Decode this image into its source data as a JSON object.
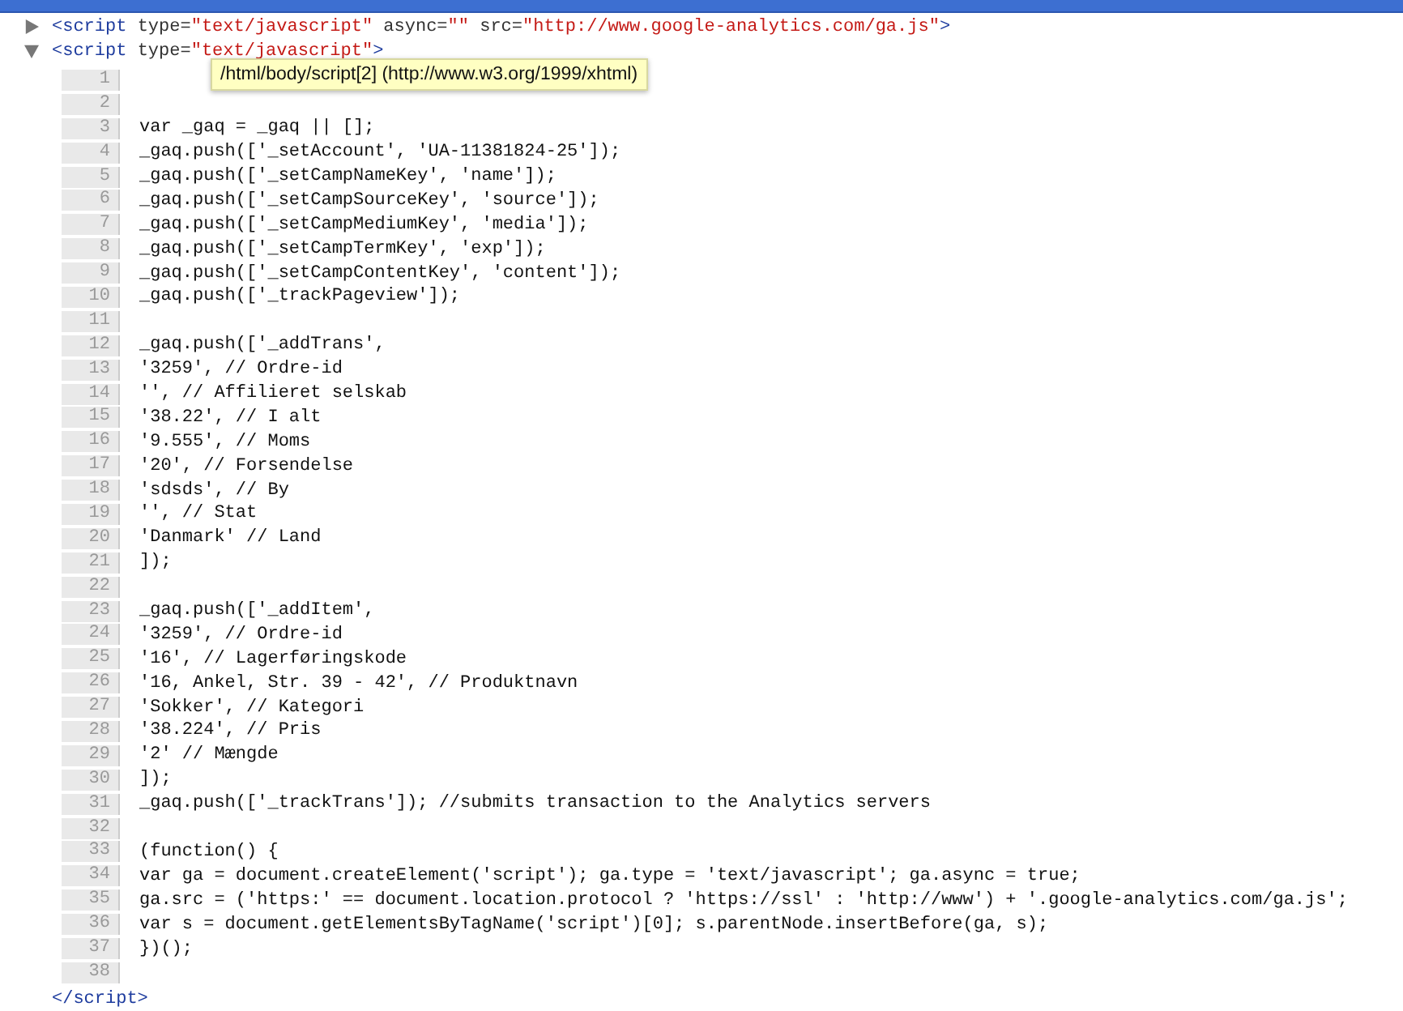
{
  "nodes": [
    {
      "expanded": false,
      "tokens": [
        {
          "kind": "tag",
          "text": "<script"
        },
        {
          "kind": "attr",
          "text": "type="
        },
        {
          "kind": "value",
          "text": "\"text/javascript\""
        },
        {
          "kind": "attr",
          "text": "async="
        },
        {
          "kind": "value",
          "text": "\"\""
        },
        {
          "kind": "attr",
          "text": "src="
        },
        {
          "kind": "value",
          "text": "\"http://www.google-analytics.com/ga.js\""
        },
        {
          "kind": "tag",
          "text": ">"
        }
      ]
    },
    {
      "expanded": true,
      "tokens": [
        {
          "kind": "tag",
          "text": "<script"
        },
        {
          "kind": "attr",
          "text": "type="
        },
        {
          "kind": "value",
          "text": "\"text/javascript\""
        },
        {
          "kind": "tag",
          "text": ">"
        }
      ],
      "code_lines": [
        {
          "number": "1"
        },
        {
          "number": "2"
        },
        {
          "number": "3",
          "text": "var _gaq = _gaq || [];"
        },
        {
          "number": "4",
          "text": "_gaq.push(['_setAccount', 'UA-11381824-25']);"
        },
        {
          "number": "5",
          "text": "_gaq.push(['_setCampNameKey', 'name']);"
        },
        {
          "number": "6",
          "text": "_gaq.push(['_setCampSourceKey', 'source']);"
        },
        {
          "number": "7",
          "text": "_gaq.push(['_setCampMediumKey', 'media']);"
        },
        {
          "number": "8",
          "text": "_gaq.push(['_setCampTermKey', 'exp']);"
        },
        {
          "number": "9",
          "text": "_gaq.push(['_setCampContentKey', 'content']);"
        },
        {
          "number": "10",
          "text": "_gaq.push(['_trackPageview']);"
        },
        {
          "number": "11"
        },
        {
          "number": "12",
          "text": "_gaq.push(['_addTrans',"
        },
        {
          "number": "13",
          "text": "'3259', // Ordre-id"
        },
        {
          "number": "14",
          "text": "'', // Affilieret selskab"
        },
        {
          "number": "15",
          "text": "'38.22', // I alt"
        },
        {
          "number": "16",
          "text": "'9.555', // Moms"
        },
        {
          "number": "17",
          "text": "'20', // Forsendelse"
        },
        {
          "number": "18",
          "text": "'sdsds', // By"
        },
        {
          "number": "19",
          "text": "'', // Stat"
        },
        {
          "number": "20",
          "text": "'Danmark' // Land"
        },
        {
          "number": "21",
          "text": "]);"
        },
        {
          "number": "22"
        },
        {
          "number": "23",
          "text": "_gaq.push(['_addItem',"
        },
        {
          "number": "24",
          "text": "'3259', // Ordre-id"
        },
        {
          "number": "25",
          "text": "'16', // Lagerføringskode"
        },
        {
          "number": "26",
          "text": "'16, Ankel, Str. 39 - 42', // Produktnavn"
        },
        {
          "number": "27",
          "text": "'Sokker', // Kategori"
        },
        {
          "number": "28",
          "text": "'38.224', // Pris"
        },
        {
          "number": "29",
          "text": "'2' // Mængde"
        },
        {
          "number": "30",
          "text": "]);"
        },
        {
          "number": "31",
          "text": "_gaq.push(['_trackTrans']); //submits transaction to the Analytics servers"
        },
        {
          "number": "32"
        },
        {
          "number": "33",
          "text": "(function() {"
        },
        {
          "number": "34",
          "text": "var ga = document.createElement('script'); ga.type = 'text/javascript'; ga.async = true;"
        },
        {
          "number": "35",
          "text": "ga.src = ('https:' == document.location.protocol ? 'https://ssl' : 'http://www') + '.google-analytics.com/ga.js';"
        },
        {
          "number": "36",
          "text": "var s = document.getElementsByTagName('script')[0]; s.parentNode.insertBefore(ga, s);"
        },
        {
          "number": "37",
          "text": "})();"
        },
        {
          "number": "38"
        }
      ],
      "closing_tag": "</script>"
    }
  ],
  "tooltip": "/html/body/script[2] (http://www.w3.org/1999/xhtml)"
}
